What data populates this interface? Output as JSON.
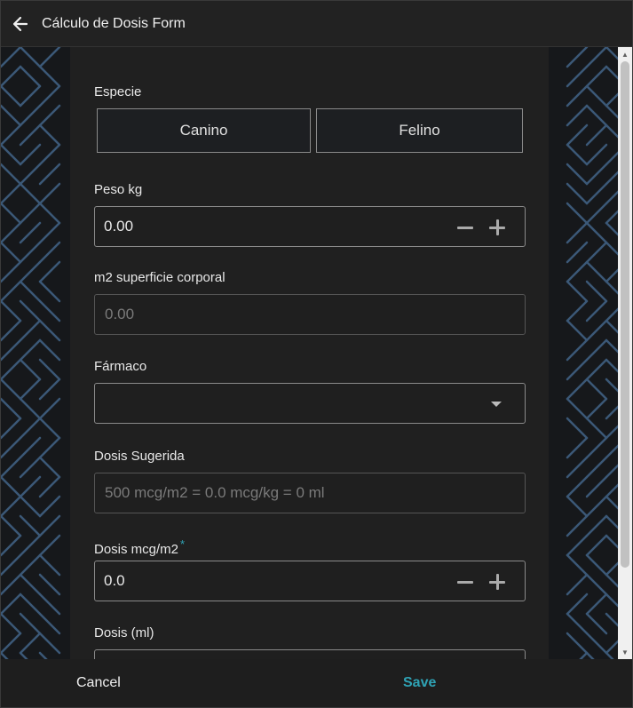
{
  "header": {
    "title": "Cálculo de Dosis Form",
    "back_icon": "arrow-left-icon"
  },
  "form": {
    "especie": {
      "label": "Especie",
      "options": [
        "Canino",
        "Felino"
      ]
    },
    "peso": {
      "label": "Peso kg",
      "value": "0.00"
    },
    "superficie": {
      "label": "m2 superficie corporal",
      "value": "0.00"
    },
    "farmaco": {
      "label": "Fármaco",
      "value": ""
    },
    "dosis_sugerida": {
      "label": "Dosis Sugerida",
      "value": "500 mcg/m2 = 0.0 mcg/kg = 0 ml"
    },
    "dosis_mcg": {
      "label": "Dosis mcg/m2",
      "required_mark": "*",
      "value": "0.0"
    },
    "dosis_ml": {
      "label": "Dosis (ml)"
    }
  },
  "footer": {
    "cancel_label": "Cancel",
    "save_label": "Save"
  },
  "colors": {
    "accent": "#2fa3b5",
    "pattern": "#3b5877",
    "background": "#16181b",
    "panel": "#202020"
  }
}
